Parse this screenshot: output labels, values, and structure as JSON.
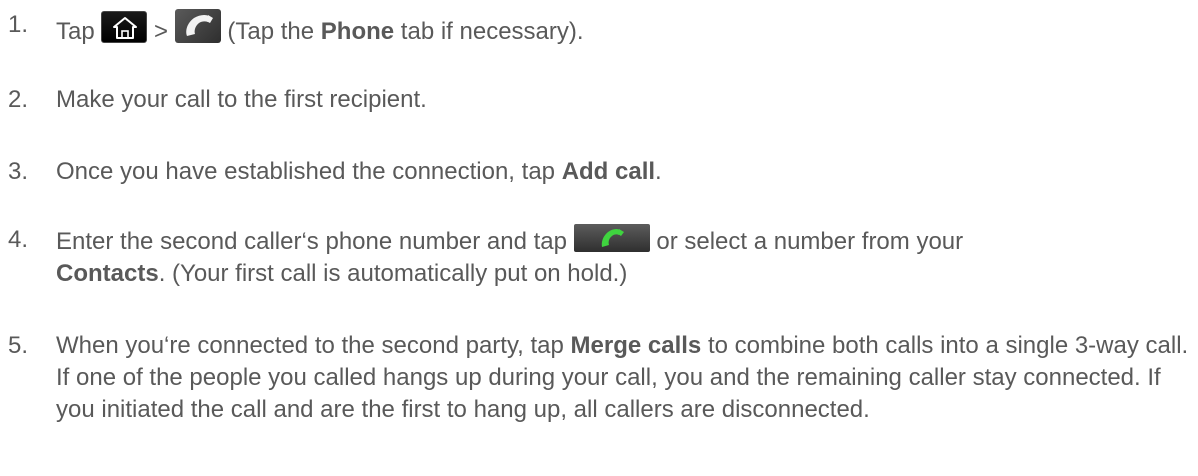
{
  "steps": [
    {
      "num": "1.",
      "parts": {
        "a": "Tap ",
        "sep": " > ",
        "b": " (Tap the ",
        "bold1": "Phone",
        "c": " tab if necessary)."
      }
    },
    {
      "num": "2.",
      "parts": {
        "a": "Make your call to the first recipient."
      }
    },
    {
      "num": "3.",
      "parts": {
        "a": "Once you have established the connection, tap ",
        "bold1": "Add call",
        "b": "."
      }
    },
    {
      "num": "4.",
      "parts": {
        "a": "Enter the second caller‘s phone number and tap ",
        "b": " or select a number from your",
        "bold1": "Contacts",
        "c": ". (Your first call is automatically put on hold.)"
      }
    },
    {
      "num": "5.",
      "parts": {
        "a": "When you‘re connected to the second party, tap ",
        "bold1": "Merge calls",
        "b": " to combine both calls into a single 3-way call. If one of the people you called hangs up during your call, you and the remaining caller stay connected. If you initiated the call and are the first to hang up, all callers are disconnected."
      }
    }
  ],
  "icons": {
    "home": "home-icon",
    "phone": "phone-app-icon",
    "call": "call-button-icon"
  },
  "colors": {
    "text": "#595959",
    "phone_green": "#3fd43f"
  }
}
